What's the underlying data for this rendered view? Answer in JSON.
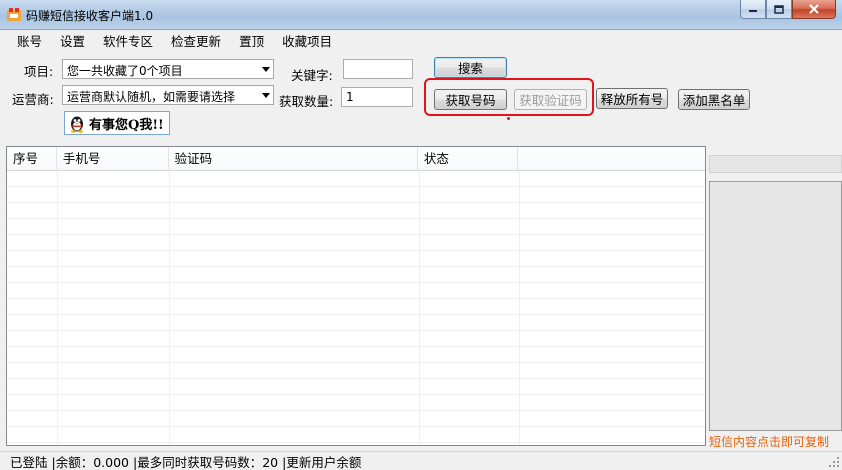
{
  "window": {
    "title": "码赚短信接收客户端1.0"
  },
  "menu": [
    "账号",
    "设置",
    "软件专区",
    "检查更新",
    "置顶",
    "收藏项目"
  ],
  "form": {
    "project_label": "项目:",
    "project_value": "您一共收藏了0个项目",
    "carrier_label": "运营商:",
    "carrier_value": "运营商默认随机，如需要请选择",
    "keyword_label": "关键字:",
    "keyword_value": "",
    "quantity_label": "获取数量:",
    "quantity_value": "1",
    "search_button": "搜索",
    "get_number_button": "获取号码",
    "get_code_button": "获取验证码",
    "release_all_button": "释放所有号",
    "add_blacklist_button": "添加黑名单",
    "qq_contact": "有事您Q我!!"
  },
  "grid": {
    "columns": [
      "序号",
      "手机号",
      "验证码",
      "状态",
      ""
    ],
    "rows": []
  },
  "sms_panel": {
    "hint": "短信内容点击即可复制"
  },
  "status": {
    "login": "已登陆",
    "balance": "|余额：0.000",
    "max_numbers": "|最多同时获取号码数：20",
    "refresh": "|更新用户余额"
  },
  "colors": {
    "highlight": "#e2141a",
    "hint": "#e8620a"
  }
}
